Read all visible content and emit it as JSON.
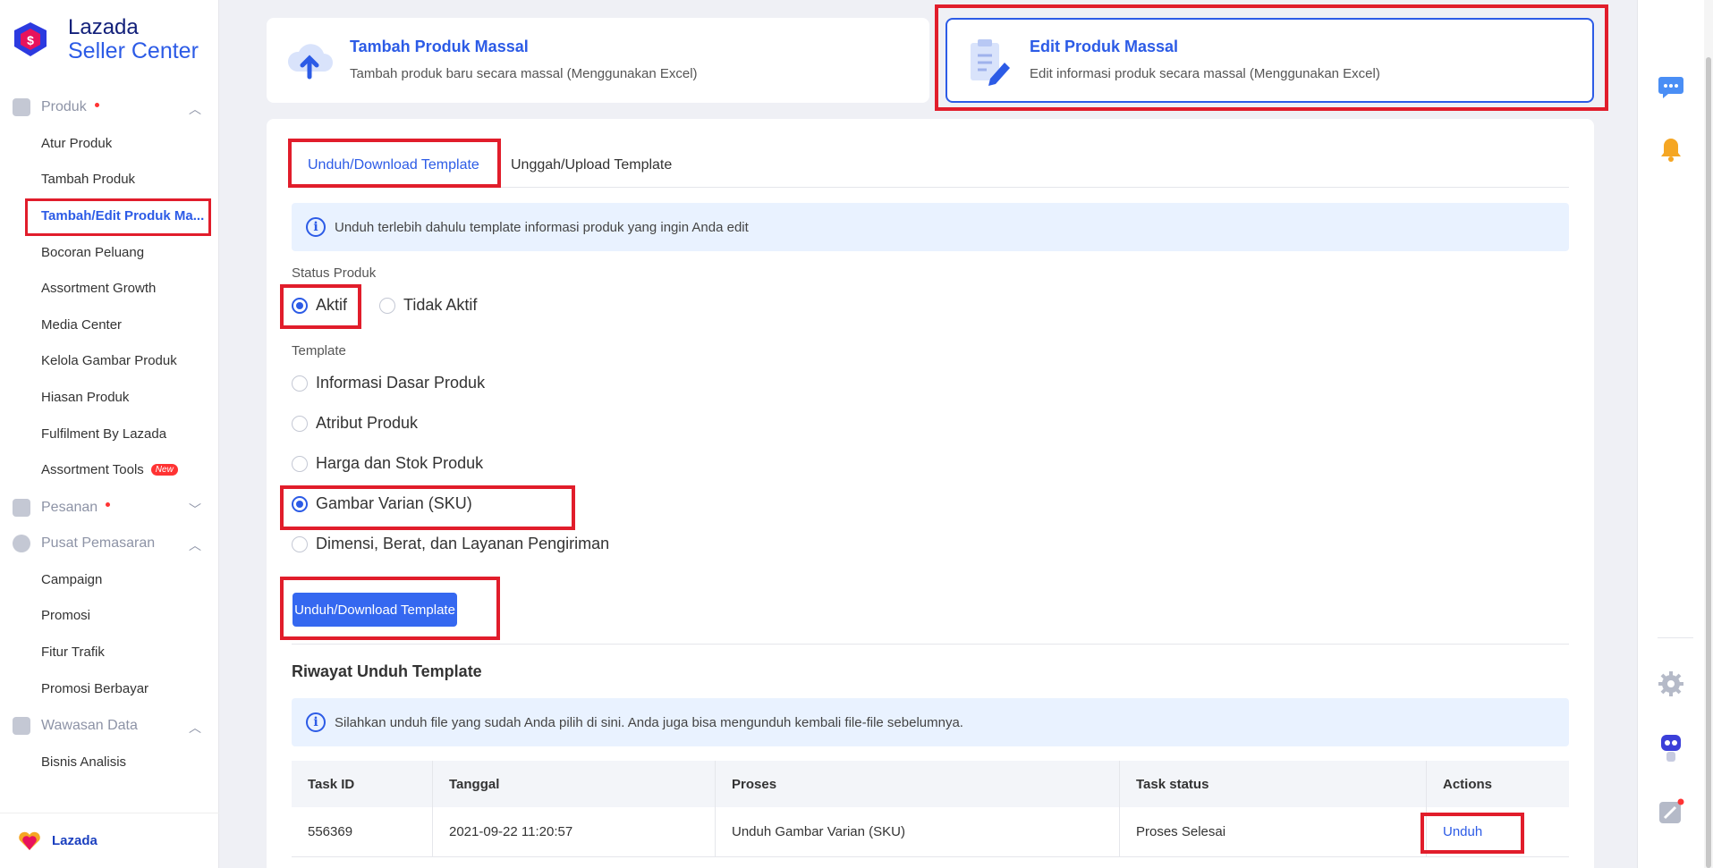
{
  "app": {
    "logo_line1": "Lazada",
    "logo_line2": "Seller Center",
    "footer_brand": "Lazada"
  },
  "sidebar": {
    "groups": [
      {
        "label": "Produk",
        "has_dot": true,
        "expanded": true,
        "items": [
          "Atur Produk",
          "Tambah Produk",
          "Tambah/Edit Produk Ma...",
          "Bocoran Peluang",
          "Assortment Growth",
          "Media Center",
          "Kelola Gambar Produk",
          "Hiasan Produk",
          "Fulfilment By Lazada",
          "Assortment Tools"
        ]
      },
      {
        "label": "Pesanan",
        "has_dot": true,
        "expanded": false,
        "items": []
      },
      {
        "label": "Pusat Pemasaran",
        "has_dot": false,
        "expanded": true,
        "items": [
          "Campaign",
          "Promosi",
          "Fitur Trafik",
          "Promosi Berbayar"
        ]
      },
      {
        "label": "Wawasan Data",
        "has_dot": false,
        "expanded": true,
        "items": [
          "Bisnis Analisis"
        ]
      }
    ],
    "active_item": "Tambah/Edit Produk Ma...",
    "new_badge": "New"
  },
  "cards": {
    "add": {
      "title": "Tambah Produk Massal",
      "subtitle": "Tambah produk baru secara massal (Menggunakan Excel)"
    },
    "edit": {
      "title": "Edit Produk Massal",
      "subtitle": "Edit informasi produk secara massal (Menggunakan Excel)"
    }
  },
  "tabs": {
    "download": "Unduh/Download Template",
    "upload": "Unggah/Upload Template"
  },
  "info": {
    "top": "Unduh terlebih dahulu template informasi produk yang ingin Anda edit",
    "history": "Silahkan unduh file yang sudah Anda pilih di sini. Anda juga bisa mengunduh kembali file-file sebelumnya."
  },
  "status": {
    "label": "Status Produk",
    "options": [
      "Aktif",
      "Tidak Aktif"
    ],
    "selected": "Aktif"
  },
  "template": {
    "label": "Template",
    "options": [
      "Informasi Dasar Produk",
      "Atribut Produk",
      "Harga dan Stok Produk",
      "Gambar Varian (SKU)",
      "Dimensi, Berat, dan Layanan Pengiriman"
    ],
    "selected": "Gambar Varian (SKU)"
  },
  "download_button": "Unduh/Download Template",
  "history": {
    "title": "Riwayat Unduh Template",
    "columns": [
      "Task ID",
      "Tanggal",
      "Proses",
      "Task status",
      "Actions"
    ],
    "rows": [
      {
        "task_id": "556369",
        "date": "2021-09-22 11:20:57",
        "process": "Unduh Gambar Varian (SKU)",
        "status": "Proses Selesai",
        "action": "Unduh"
      }
    ]
  },
  "colors": {
    "accent": "#2c5be6",
    "highlight": "#e11d2b",
    "info_bg": "#e9f2ff"
  }
}
